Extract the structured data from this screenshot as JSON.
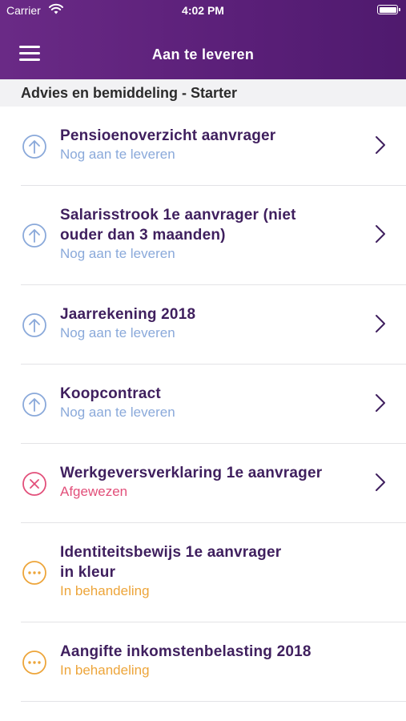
{
  "status_bar": {
    "carrier": "Carrier",
    "time": "4:02 PM"
  },
  "header": {
    "title": "Aan te leveren"
  },
  "section": {
    "title": "Advies en bemiddeling - Starter"
  },
  "colors": {
    "header": "#5a1f78",
    "open": "#8aa9da",
    "rejected": "#e24f7a",
    "processing": "#eda53a",
    "item_title": "#3f1f5e"
  },
  "items": [
    {
      "name_lines": [
        "Pensioenoverzicht aanvrager"
      ],
      "status": "Nog aan te leveren",
      "state": "open",
      "icon": "upload-arrow-icon",
      "chevron": true
    },
    {
      "name_lines": [
        "Salarisstrook 1e aanvrager (niet",
        "ouder dan 3 maanden)"
      ],
      "status": "Nog aan te leveren",
      "state": "open",
      "icon": "upload-arrow-icon",
      "chevron": true
    },
    {
      "name_lines": [
        "Jaarrekening 2018"
      ],
      "status": "Nog aan te leveren",
      "state": "open",
      "icon": "upload-arrow-icon",
      "chevron": true
    },
    {
      "name_lines": [
        "Koopcontract"
      ],
      "status": "Nog aan te leveren",
      "state": "open",
      "icon": "upload-arrow-icon",
      "chevron": true
    },
    {
      "name_lines": [
        "Werkgeversverklaring 1e aanvrager"
      ],
      "status": "Afgewezen",
      "state": "rejected",
      "icon": "rejected-x-icon",
      "chevron": true
    },
    {
      "name_lines": [
        "Identiteitsbewijs 1e aanvrager",
        "in kleur"
      ],
      "status": "In behandeling",
      "state": "processing",
      "icon": "processing-dots-icon",
      "chevron": false
    },
    {
      "name_lines": [
        "Aangifte inkomstenbelasting 2018"
      ],
      "status": "In behandeling",
      "state": "processing",
      "icon": "processing-dots-icon",
      "chevron": false
    }
  ]
}
